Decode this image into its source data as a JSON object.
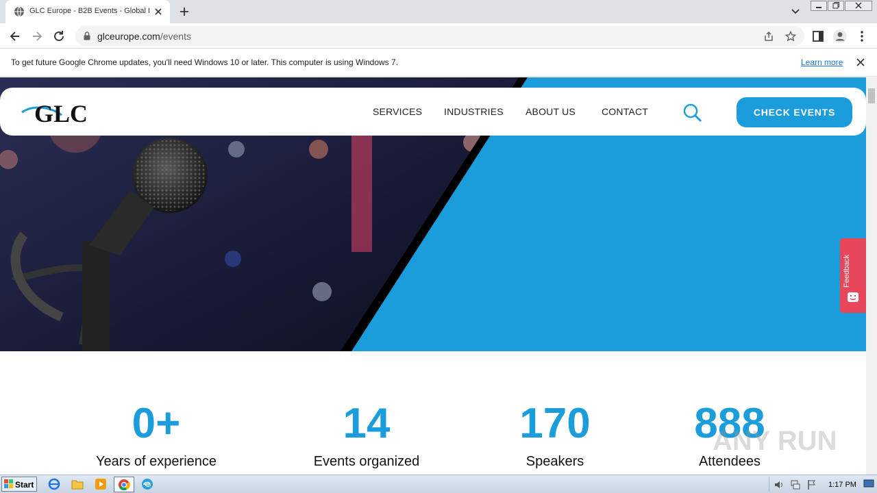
{
  "browser": {
    "tab_title": "GLC Europe - B2B Events - Global Le",
    "url_host": "glceurope.com",
    "url_path": "/events",
    "infobar_text": "To get future Google Chrome updates, you'll need Windows 10 or later. This computer is using Windows 7.",
    "infobar_link": "Learn more"
  },
  "site": {
    "logo_text": "GLC",
    "nav": [
      "SERVICES",
      "INDUSTRIES",
      "ABOUT US",
      "CONTACT"
    ],
    "cta": "CHECK EVENTS",
    "feedback": "Feedback",
    "accent_color": "#1b9ddb"
  },
  "stats": [
    {
      "value": "0+",
      "label": "Years of experience"
    },
    {
      "value": "14",
      "label": "Events organized"
    },
    {
      "value": "170",
      "label": "Speakers"
    },
    {
      "value": "888",
      "label": "Attendees"
    }
  ],
  "taskbar": {
    "start": "Start",
    "clock": "1:17 PM"
  },
  "watermark": "ANY RUN"
}
